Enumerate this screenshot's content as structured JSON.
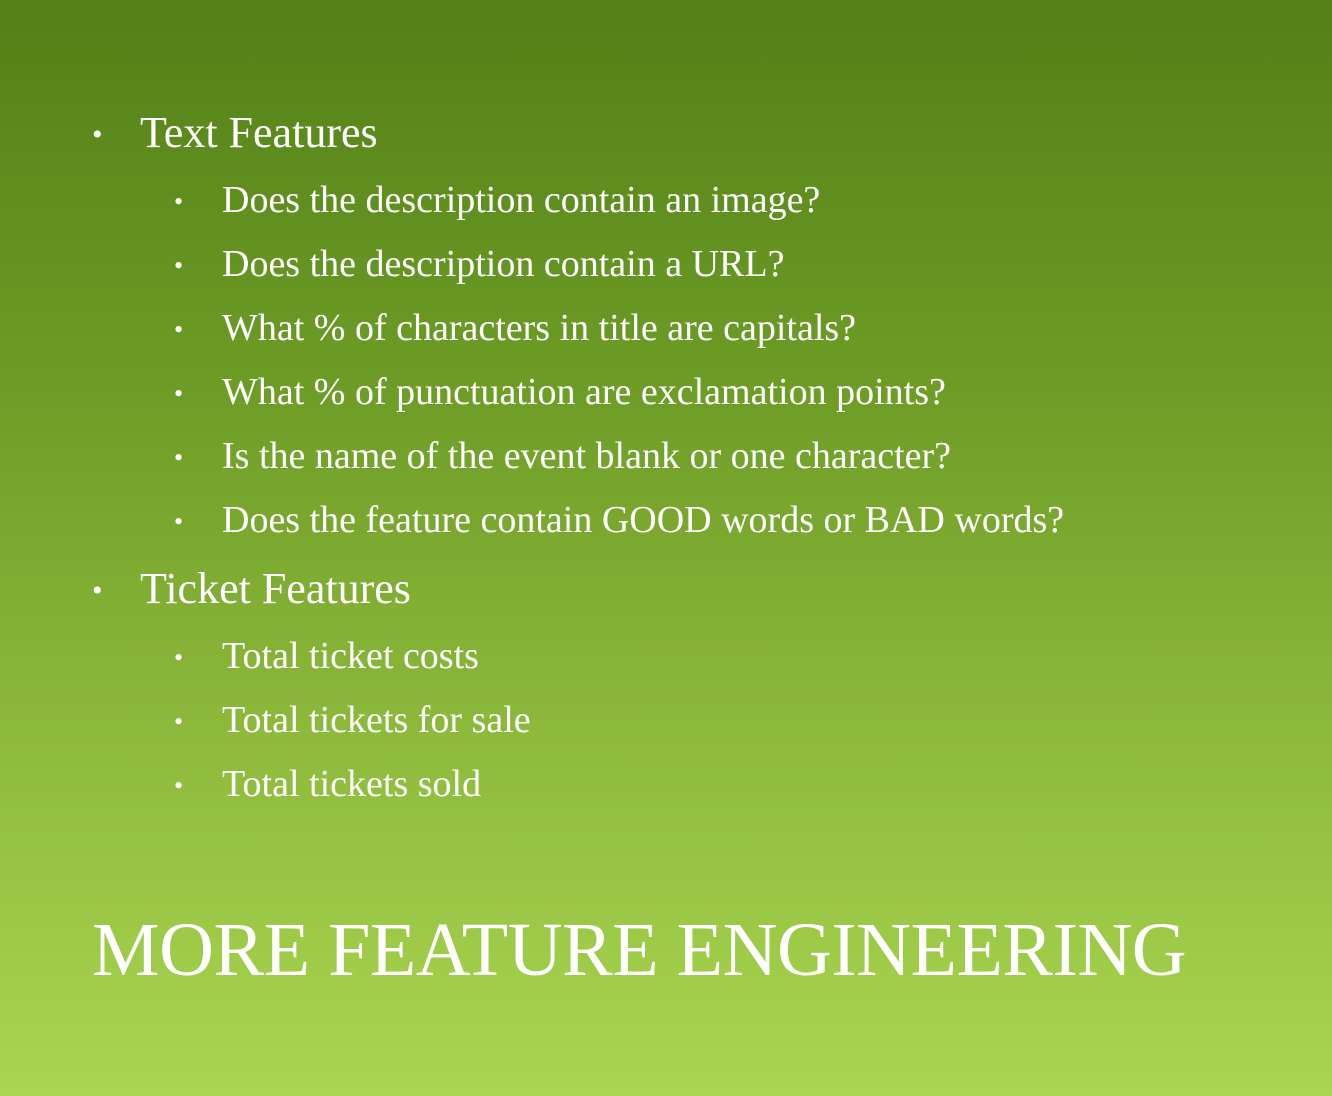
{
  "slide": {
    "title": "MORE FEATURE ENGINEERING",
    "bullet_glyph": "•",
    "sections": [
      {
        "label": "Text Features",
        "items": [
          "Does the description contain an image?",
          "Does the description contain a URL?",
          "What % of characters in title are capitals?",
          "What % of punctuation are exclamation points?",
          "Is the name of the event blank or one character?",
          "Does the feature contain GOOD words or BAD words?"
        ]
      },
      {
        "label": "Ticket Features",
        "items": [
          "Total ticket costs",
          "Total tickets for sale",
          "Total tickets sold"
        ]
      }
    ]
  },
  "colors": {
    "gradient_top": "#538017",
    "gradient_bottom": "#a9d650",
    "text": "#ffffff"
  }
}
